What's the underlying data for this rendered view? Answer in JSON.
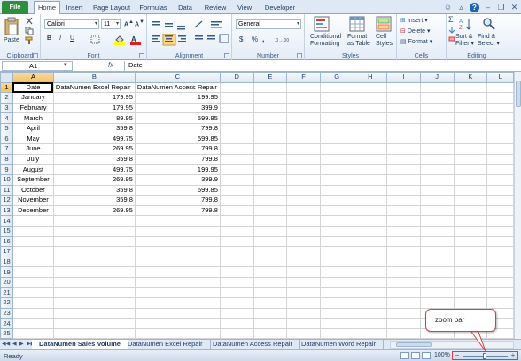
{
  "tabs": [
    "File",
    "Home",
    "Insert",
    "Page Layout",
    "Formulas",
    "Data",
    "Review",
    "View",
    "Developer"
  ],
  "active_tab": "Home",
  "ribbon": {
    "clipboard": {
      "paste": "Paste",
      "label": "Clipboard"
    },
    "font": {
      "name": "Calibri",
      "size": "11",
      "label": "Font",
      "bold": "B",
      "italic": "I",
      "underline": "U"
    },
    "alignment": {
      "label": "Alignment"
    },
    "number": {
      "format": "General",
      "label": "Number",
      "currency": "$",
      "percent": "%",
      "comma": ","
    },
    "styles": {
      "cond": "Conditional",
      "cond2": "Formatting",
      "fmt_table": "Format",
      "fmt_table2": "as Table",
      "cell_styles": "Cell",
      "cell_styles2": "Styles",
      "label": "Styles"
    },
    "cells": {
      "insert": "Insert",
      "delete": "Delete",
      "format": "Format",
      "label": "Cells"
    },
    "editing": {
      "sort": "Sort &",
      "sort2": "Filter",
      "find": "Find &",
      "find2": "Select",
      "label": "Editing",
      "sigma": "Σ"
    }
  },
  "formula_bar": {
    "name_box": "A1",
    "fx": "fx",
    "content": "Date"
  },
  "columns": [
    "A",
    "B",
    "C",
    "D",
    "E",
    "F",
    "G",
    "H",
    "I",
    "J",
    "K",
    "L"
  ],
  "headers": [
    "Date",
    "DataNumen Excel Repair",
    "DataNumen Access Repair"
  ],
  "rows": [
    [
      "January",
      "179.95",
      "199.95"
    ],
    [
      "February",
      "179.95",
      "399.9"
    ],
    [
      "March",
      "89.95",
      "599.85"
    ],
    [
      "April",
      "359.8",
      "799.8"
    ],
    [
      "May",
      "499.75",
      "599.85"
    ],
    [
      "June",
      "269.95",
      "799.8"
    ],
    [
      "July",
      "359.8",
      "799.8"
    ],
    [
      "August",
      "499.75",
      "199.95"
    ],
    [
      "September",
      "269.95",
      "399.9"
    ],
    [
      "October",
      "359.8",
      "599.85"
    ],
    [
      "November",
      "359.8",
      "799.8"
    ],
    [
      "December",
      "269.95",
      "799.8"
    ]
  ],
  "row_numbers": [
    "1",
    "2",
    "3",
    "4",
    "5",
    "6",
    "7",
    "8",
    "9",
    "10",
    "11",
    "12",
    "13",
    "14",
    "15",
    "16",
    "17",
    "18",
    "19",
    "20",
    "21",
    "22",
    "23",
    "24",
    "25"
  ],
  "sheet_tabs": [
    "DataNumen Sales Volume",
    "DataNumen Excel Repair",
    "DataNumen Access Repair",
    "DataNumen Word Repair"
  ],
  "active_sheet": "DataNumen Sales Volume",
  "status": {
    "ready": "Ready",
    "zoom": "100%",
    "zoom_level_percent": 100
  },
  "callout": {
    "text": "zoom bar",
    "border_color": "#cc4444"
  },
  "colors": {
    "file_tab": "#2f8e3d",
    "selection_header": "#f1c15f",
    "callout_border": "#e03a3a"
  }
}
